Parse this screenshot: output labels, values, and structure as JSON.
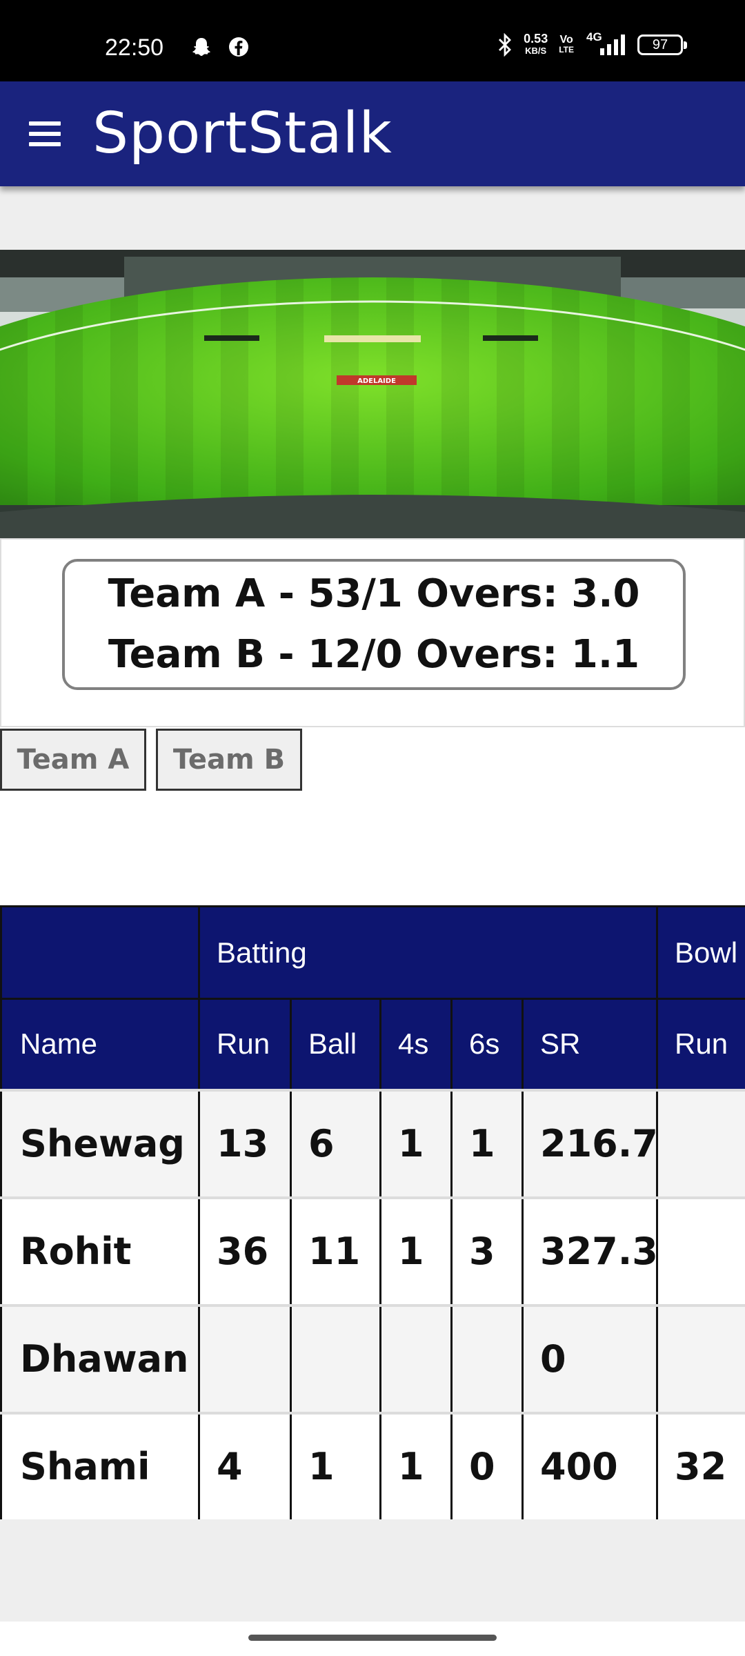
{
  "status_bar": {
    "time": "22:50",
    "net_speed_value": "0.53",
    "net_speed_unit": "KB/S",
    "volte_top": "Vo",
    "volte_bottom": "LTE",
    "network": "4G",
    "battery": "97"
  },
  "app_bar": {
    "title": "SportStalk",
    "menu_icon": "hamburger-menu-icon"
  },
  "colors": {
    "app_bar": "#1a237e",
    "table_header": "#0d1570"
  },
  "stadium_image": {
    "banner_text": "ADELAIDE"
  },
  "score_summary": {
    "line_a": "Team A - 53/1 Overs: 3.0",
    "line_b": "Team B - 12/0 Overs: 1.1"
  },
  "tabs": [
    {
      "label": "Team A"
    },
    {
      "label": "Team B"
    }
  ],
  "table": {
    "group_headers": {
      "blank": "",
      "batting": "Batting",
      "bowling": "Bowl"
    },
    "columns": [
      "Name",
      "Run",
      "Ball",
      "4s",
      "6s",
      "SR",
      "Run"
    ],
    "rows": [
      {
        "name": "Shewag",
        "run": "13",
        "ball": "6",
        "fours": "1",
        "sixes": "1",
        "sr": "216.7",
        "bowl_run": ""
      },
      {
        "name": "Rohit",
        "run": "36",
        "ball": "11",
        "fours": "1",
        "sixes": "3",
        "sr": "327.3",
        "bowl_run": ""
      },
      {
        "name": "Dhawan",
        "run": "",
        "ball": "",
        "fours": "",
        "sixes": "",
        "sr": "0",
        "bowl_run": ""
      },
      {
        "name": "Shami",
        "run": "4",
        "ball": "1",
        "fours": "1",
        "sixes": "0",
        "sr": "400",
        "bowl_run": "32"
      }
    ]
  }
}
